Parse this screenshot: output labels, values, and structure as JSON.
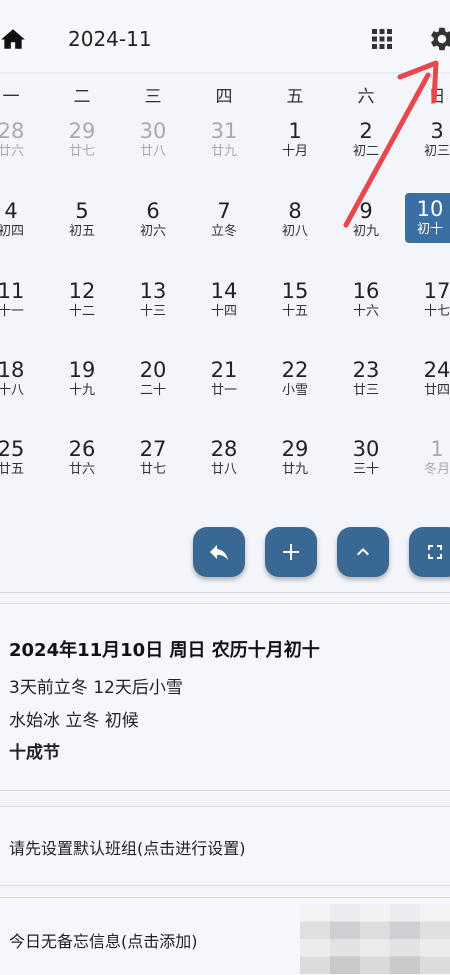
{
  "header": {
    "title": "2024-11",
    "icons": {
      "home": "home-icon",
      "grid": "apps-grid-icon",
      "settings": "gear-icon"
    }
  },
  "weekdays": [
    "一",
    "二",
    "三",
    "四",
    "五",
    "六",
    "日"
  ],
  "calendar": {
    "weeks": [
      [
        {
          "num": "28",
          "lunar": "廿六",
          "other": true
        },
        {
          "num": "29",
          "lunar": "廿七",
          "other": true
        },
        {
          "num": "30",
          "lunar": "廿八",
          "other": true
        },
        {
          "num": "31",
          "lunar": "廿九",
          "other": true
        },
        {
          "num": "1",
          "lunar": "十月"
        },
        {
          "num": "2",
          "lunar": "初二"
        },
        {
          "num": "3",
          "lunar": "初三"
        }
      ],
      [
        {
          "num": "4",
          "lunar": "初四"
        },
        {
          "num": "5",
          "lunar": "初五"
        },
        {
          "num": "6",
          "lunar": "初六"
        },
        {
          "num": "7",
          "lunar": "立冬"
        },
        {
          "num": "8",
          "lunar": "初八"
        },
        {
          "num": "9",
          "lunar": "初九"
        },
        {
          "num": "10",
          "lunar": "初十",
          "today": true
        }
      ],
      [
        {
          "num": "11",
          "lunar": "十一"
        },
        {
          "num": "12",
          "lunar": "十二"
        },
        {
          "num": "13",
          "lunar": "十三"
        },
        {
          "num": "14",
          "lunar": "十四"
        },
        {
          "num": "15",
          "lunar": "十五"
        },
        {
          "num": "16",
          "lunar": "十六"
        },
        {
          "num": "17",
          "lunar": "十七"
        }
      ],
      [
        {
          "num": "18",
          "lunar": "十八"
        },
        {
          "num": "19",
          "lunar": "十九"
        },
        {
          "num": "20",
          "lunar": "二十"
        },
        {
          "num": "21",
          "lunar": "廿一"
        },
        {
          "num": "22",
          "lunar": "小雪"
        },
        {
          "num": "23",
          "lunar": "廿三"
        },
        {
          "num": "24",
          "lunar": "廿四"
        }
      ],
      [
        {
          "num": "25",
          "lunar": "廿五"
        },
        {
          "num": "26",
          "lunar": "廿六"
        },
        {
          "num": "27",
          "lunar": "廿七"
        },
        {
          "num": "28",
          "lunar": "廿八"
        },
        {
          "num": "29",
          "lunar": "廿九"
        },
        {
          "num": "30",
          "lunar": "三十"
        },
        {
          "num": "1",
          "lunar": "冬月",
          "other": true
        }
      ]
    ]
  },
  "actions": [
    {
      "name": "back-button",
      "icon": "reply-icon"
    },
    {
      "name": "add-button",
      "icon": "plus-icon"
    },
    {
      "name": "collapse-button",
      "icon": "chevron-up-icon"
    },
    {
      "name": "fullscreen-button",
      "icon": "fullscreen-icon"
    }
  ],
  "info": {
    "date_line": "2024年11月10日 周日 农历十月初十",
    "solar_terms": "3天前立冬  12天后小雪",
    "phenology": "水始冰 立冬 初候",
    "festival": "十成节"
  },
  "shift": {
    "prompt": "请先设置默认班组(点击进行设置)"
  },
  "memo": {
    "prompt": "今日无备忘信息(点击添加)"
  },
  "colors": {
    "accent": "#3a6895",
    "today_bg": "#3b6ea2",
    "annotation": "#e8474d"
  }
}
